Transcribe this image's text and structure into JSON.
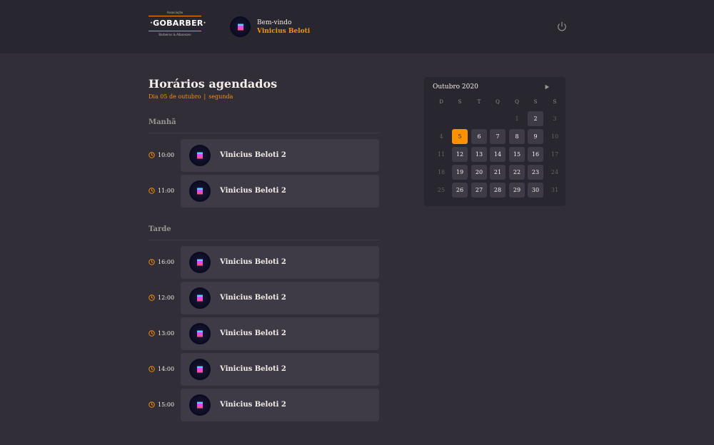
{
  "header": {
    "logo": {
      "top": "Associação",
      "name": "GOBARBER",
      "bottom": "Barbeiros & Albanezes"
    },
    "welcome": "Bem-vindo",
    "user_name": "Vinicius Beloti"
  },
  "schedule": {
    "title": "Horários agendados",
    "date_text": "Dia 05 de outubro",
    "separator": "|",
    "weekday": "segunda",
    "morning": {
      "label": "Manhã",
      "appointments": [
        {
          "time": "10:00",
          "name": "Vinicius Beloti 2"
        },
        {
          "time": "11:00",
          "name": "Vinicius Beloti 2"
        }
      ]
    },
    "afternoon": {
      "label": "Tarde",
      "appointments": [
        {
          "time": "16:00",
          "name": "Vinicius Beloti 2"
        },
        {
          "time": "12:00",
          "name": "Vinicius Beloti 2"
        },
        {
          "time": "13:00",
          "name": "Vinicius Beloti 2"
        },
        {
          "time": "14:00",
          "name": "Vinicius Beloti 2"
        },
        {
          "time": "15:00",
          "name": "Vinicius Beloti 2"
        }
      ]
    }
  },
  "calendar": {
    "month": "Outubro 2020",
    "weekdays": [
      "D",
      "S",
      "T",
      "Q",
      "Q",
      "S",
      "S"
    ],
    "weeks": [
      [
        null,
        null,
        null,
        null,
        "1",
        "2",
        "3"
      ],
      [
        "4",
        "5",
        "6",
        "7",
        "8",
        "9",
        "10"
      ],
      [
        "11",
        "12",
        "13",
        "14",
        "15",
        "16",
        "17"
      ],
      [
        "18",
        "19",
        "20",
        "21",
        "22",
        "23",
        "24"
      ],
      [
        "25",
        "26",
        "27",
        "28",
        "29",
        "30",
        "31"
      ]
    ],
    "selected_day": "5",
    "available_days": [
      "2",
      "6",
      "7",
      "8",
      "9",
      "12",
      "13",
      "14",
      "15",
      "16",
      "19",
      "20",
      "21",
      "22",
      "23",
      "26",
      "27",
      "28",
      "29",
      "30"
    ]
  },
  "colors": {
    "accent": "#ff9000",
    "background": "#312e38",
    "header": "#28262e",
    "card": "#3e3b47",
    "text": "#f4ede8",
    "muted": "#999591"
  },
  "icons": {
    "logout": "power-icon",
    "time": "clock-icon",
    "next_month": "chevron-right-icon"
  }
}
